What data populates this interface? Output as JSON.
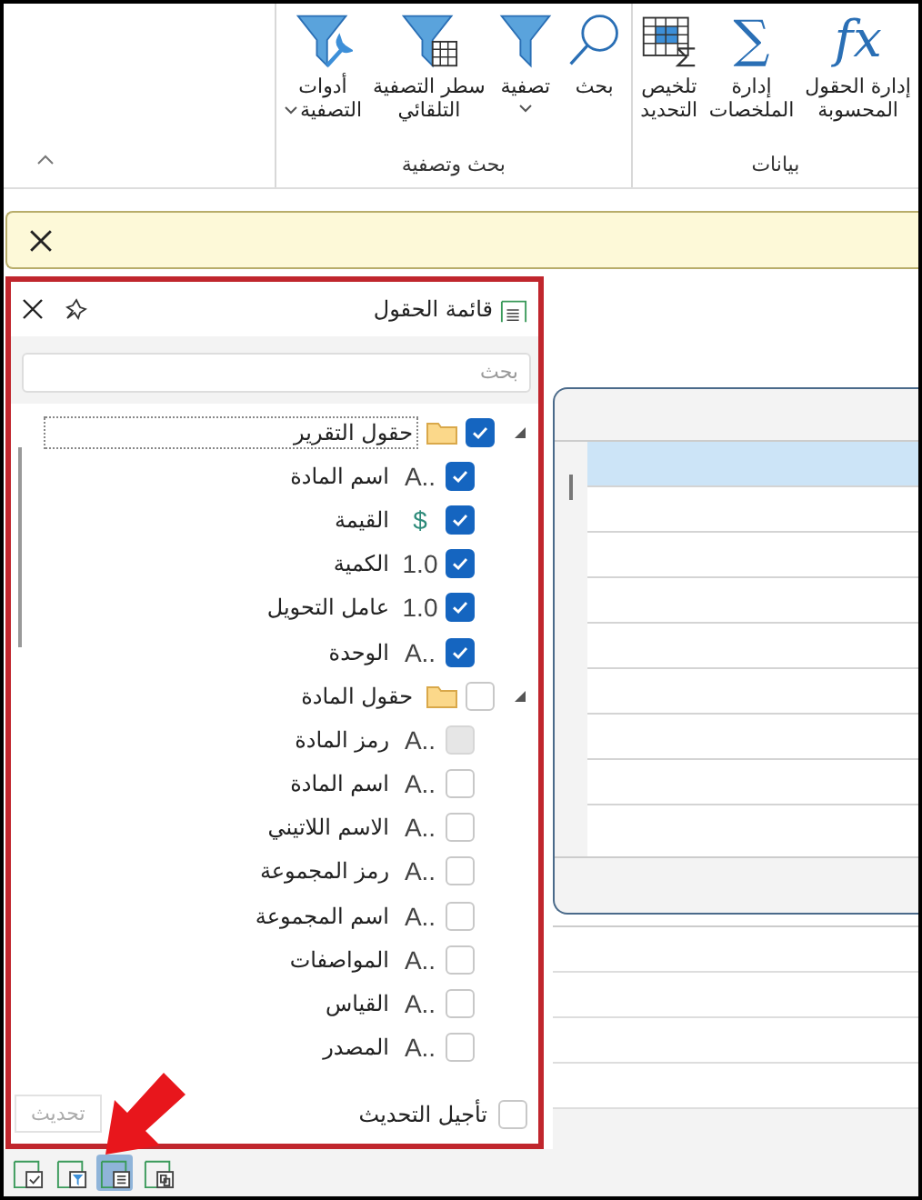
{
  "ribbon": {
    "groups": [
      {
        "label": "بيانات",
        "buttons": [
          {
            "kind": "glyph",
            "glyph": "fx",
            "lines": [
              "إدارة الحقول",
              "المحسوبة"
            ],
            "dropdown": false
          },
          {
            "kind": "glyph",
            "glyph": "∑",
            "lines": [
              "إدارة",
              "الملخصات"
            ],
            "dropdown": false
          },
          {
            "kind": "summary-grid",
            "lines": [
              "تلخيص",
              "التحديد"
            ],
            "dropdown": false
          }
        ]
      },
      {
        "label": "بحث وتصفية",
        "buttons": [
          {
            "kind": "search",
            "lines": [
              "بحث"
            ],
            "dropdown": false
          },
          {
            "kind": "filter",
            "lines": [
              "تصفية"
            ],
            "dropdown": true
          },
          {
            "kind": "filter-grid",
            "lines": [
              "سطر التصفية",
              "التلقائي"
            ],
            "dropdown": false
          },
          {
            "kind": "filter-wrench",
            "lines": [
              "أدوات",
              "التصفية"
            ],
            "dropdown": true
          }
        ]
      }
    ]
  },
  "field_list": {
    "title": "قائمة الحقول",
    "search": {
      "placeholder": "بحث"
    },
    "tree": [
      {
        "label": "حقول التقرير",
        "checked": true,
        "expanded": true,
        "focused": true,
        "children": [
          {
            "label": "اسم المادة",
            "icon": "A..",
            "kind": "text",
            "checked": true,
            "disabled": false
          },
          {
            "label": "القيمة",
            "icon": "$",
            "kind": "currency",
            "checked": true,
            "disabled": false
          },
          {
            "label": "الكمية",
            "icon": "1.0",
            "kind": "number",
            "checked": true,
            "disabled": false
          },
          {
            "label": "عامل التحويل",
            "icon": "1.0",
            "kind": "number",
            "checked": true,
            "disabled": false
          },
          {
            "label": "الوحدة",
            "icon": "A..",
            "kind": "text",
            "checked": true,
            "disabled": false
          }
        ]
      },
      {
        "label": "حقول المادة",
        "checked": false,
        "expanded": true,
        "focused": false,
        "children": [
          {
            "label": "رمز المادة",
            "icon": "A..",
            "kind": "text",
            "checked": false,
            "disabled": true
          },
          {
            "label": "اسم المادة",
            "icon": "A..",
            "kind": "text",
            "checked": false,
            "disabled": false
          },
          {
            "label": "الاسم اللاتيني",
            "icon": "A..",
            "kind": "text",
            "checked": false,
            "disabled": false
          },
          {
            "label": "رمز المجموعة",
            "icon": "A..",
            "kind": "text",
            "checked": false,
            "disabled": false
          },
          {
            "label": "اسم المجموعة",
            "icon": "A..",
            "kind": "text",
            "checked": false,
            "disabled": false
          },
          {
            "label": "المواصفات",
            "icon": "A..",
            "kind": "text",
            "checked": false,
            "disabled": false
          },
          {
            "label": "القياس",
            "icon": "A..",
            "kind": "text",
            "checked": false,
            "disabled": false
          },
          {
            "label": "المصدر",
            "icon": "A..",
            "kind": "text",
            "checked": false,
            "disabled": false
          }
        ]
      }
    ],
    "defer": {
      "label": "تأجيل التحديث",
      "checked": false
    },
    "update_button": {
      "label": "تحديث",
      "disabled": true
    }
  },
  "grid": {
    "rows": [
      {
        "selected": true
      },
      {
        "selected": false
      },
      {
        "selected": false
      },
      {
        "selected": false
      },
      {
        "selected": false
      },
      {
        "selected": false
      },
      {
        "selected": false
      },
      {
        "selected": false
      }
    ]
  },
  "bottom_tabs": [
    {
      "kind": "check",
      "selected": false
    },
    {
      "kind": "filter",
      "selected": false
    },
    {
      "kind": "list",
      "selected": true
    },
    {
      "kind": "copy",
      "selected": false
    }
  ]
}
